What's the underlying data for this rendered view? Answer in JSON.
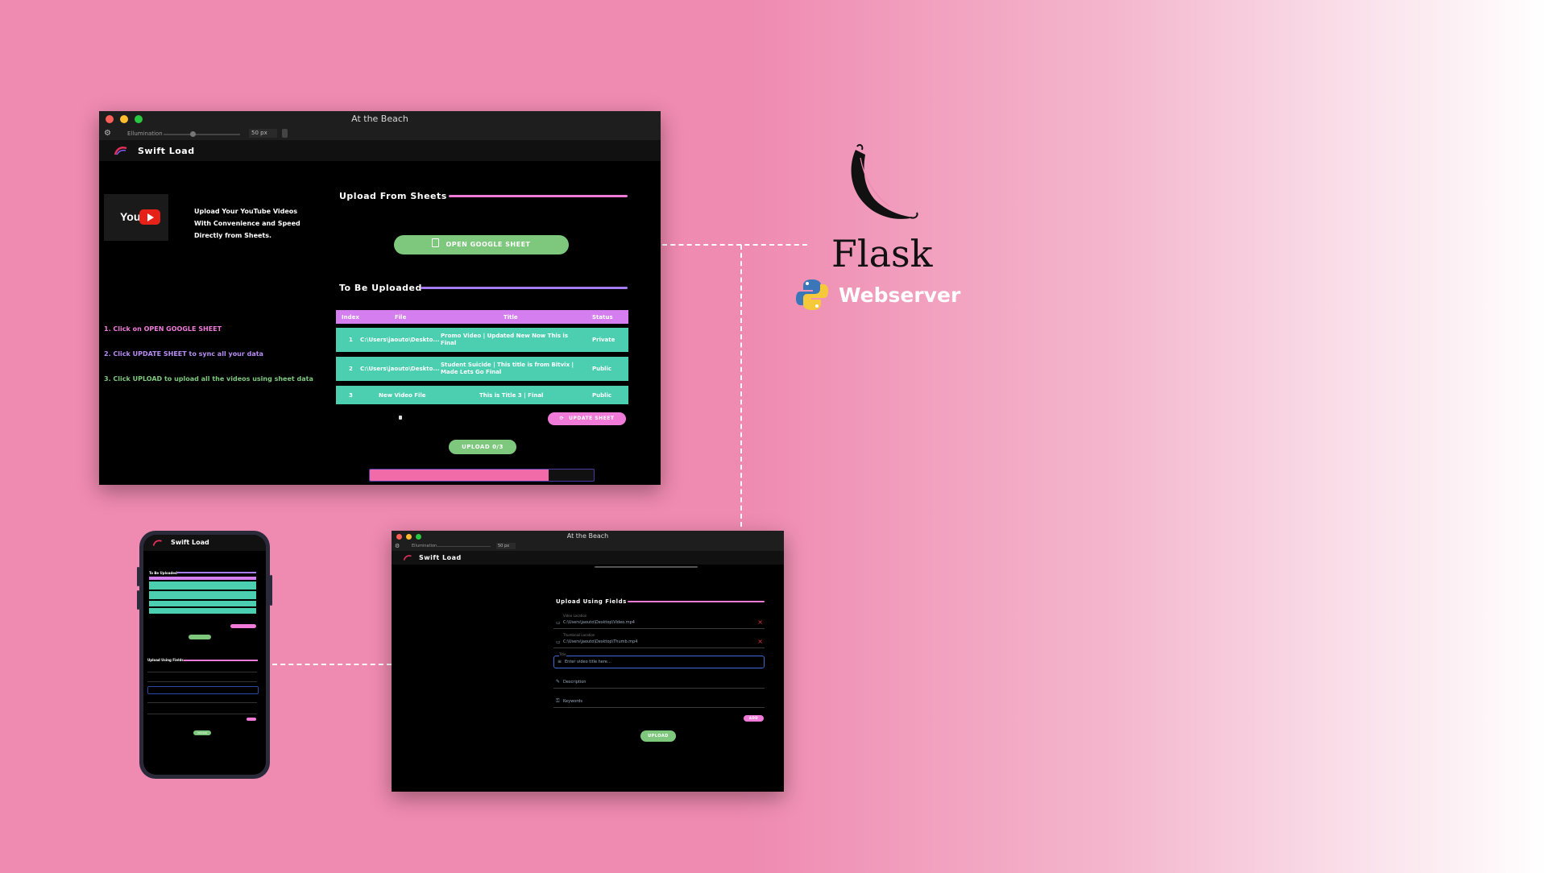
{
  "colors": {
    "pink": "#f07ad8",
    "purple": "#a77bf2",
    "teal": "#4bcfb0",
    "green": "#7ec87e",
    "header": "#d57ef0",
    "bg": "#ef8ab0"
  },
  "desktop": {
    "window_title": "At the Beach",
    "toolbar": {
      "gear_icon": "gear-icon",
      "label": "Ellumination",
      "size_value": "50 px"
    },
    "app_name": "Swift Load",
    "logo_text": "You",
    "tagline": [
      "Upload Your YouTube Videos",
      "With Convenience and Speed",
      "Directly from Sheets."
    ],
    "steps": [
      "1. Click on OPEN GOOGLE SHEET",
      "2. Click UPDATE SHEET to sync all your data",
      "3. Click UPLOAD to upload all the videos using sheet data"
    ],
    "upload_sheets_title": "Upload From Sheets",
    "open_sheet_label": "OPEN GOOGLE SHEET",
    "to_upload_title": "To Be Uploaded",
    "table": {
      "headers": [
        "Index",
        "File",
        "Title",
        "Status"
      ],
      "rows": [
        [
          "1",
          "C:\\Users\\jaouto\\Deskto...",
          "Promo Video | Updated New Now This is Final",
          "Private"
        ],
        [
          "2",
          "C:\\Users\\jaouto\\Deskto...",
          "Student Suicide | This title is from Bitvix | Made Lets Go Final",
          "Public"
        ],
        [
          "3",
          "New Video File",
          "This is Title 3 | Final",
          "Public"
        ]
      ]
    },
    "update_sheet_label": "UPDATE SHEET",
    "upload_label": "UPLOAD 0/3",
    "progress": 0.8
  },
  "flask": {
    "name": "Flask",
    "webserver_label": "Webserver"
  },
  "tablet": {
    "window_title": "At the Beach",
    "toolbar": {
      "label": "Ellumination",
      "size_value": "50 px"
    },
    "app_name": "Swift Load",
    "fields_title": "Upload Using Fields",
    "fields": [
      {
        "label": "Video Location",
        "value": "C:\\Users\\jaouto\\Desktop\\Video.mp4"
      },
      {
        "label": "Thumbnail Location",
        "value": "C:\\Users\\jaouto\\Desktop\\Thumb.mp4"
      },
      {
        "label": "Title",
        "value": "Enter video title here..."
      },
      {
        "label": "",
        "value": "Description"
      },
      {
        "label": "",
        "value": "Keywords"
      }
    ],
    "small_btn_label": "ADD",
    "upload_label": "UPLOAD"
  },
  "phone": {
    "app_name": "Swift Load",
    "to_upload_title": "To Be Uploaded",
    "fields_title": "Upload Using Fields",
    "upload_label": "UPLOAD"
  }
}
